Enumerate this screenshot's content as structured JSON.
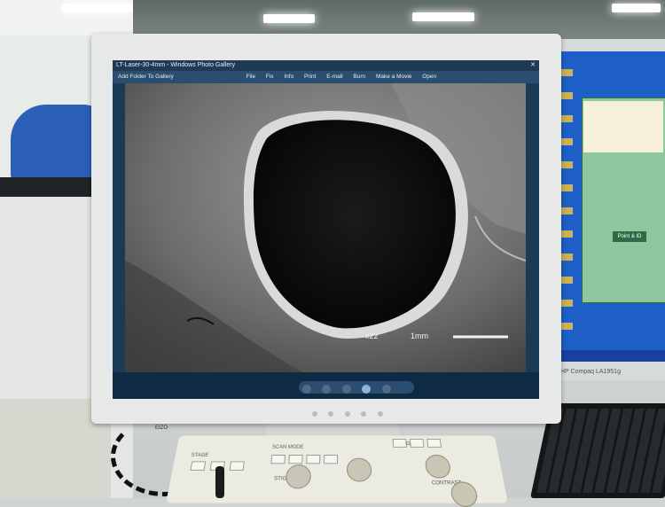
{
  "photo_viewer": {
    "window_title": "LT-Laser-30-4mm - Windows Photo Gallery",
    "toolbar": {
      "add_folder": "Add Folder To Gallery",
      "file": "File",
      "fix": "Fix",
      "info": "Info",
      "print": "Print",
      "email": "E-mail",
      "burn": "Burn",
      "make_movie": "Make a Movie",
      "open": "Open"
    },
    "image": {
      "magnification": "x22",
      "scale_bar_label": "1mm"
    }
  },
  "control_console": {
    "labels": {
      "stage": "STAGE",
      "scan_mode": "SCAN MODE",
      "stigma": "STIGMA",
      "image": "IMAGE",
      "contrast": "CONTRAST"
    }
  },
  "right_monitor": {
    "dialog_button": "Point & ID",
    "brand_label": "HP Compaq LA1951g"
  },
  "main_monitor_brand": "EIZO",
  "colors": {
    "sem_background": "#5f615f",
    "hole": "#0b0c0c",
    "viewer_chrome": "#203a55",
    "console": "#ecebe2"
  }
}
